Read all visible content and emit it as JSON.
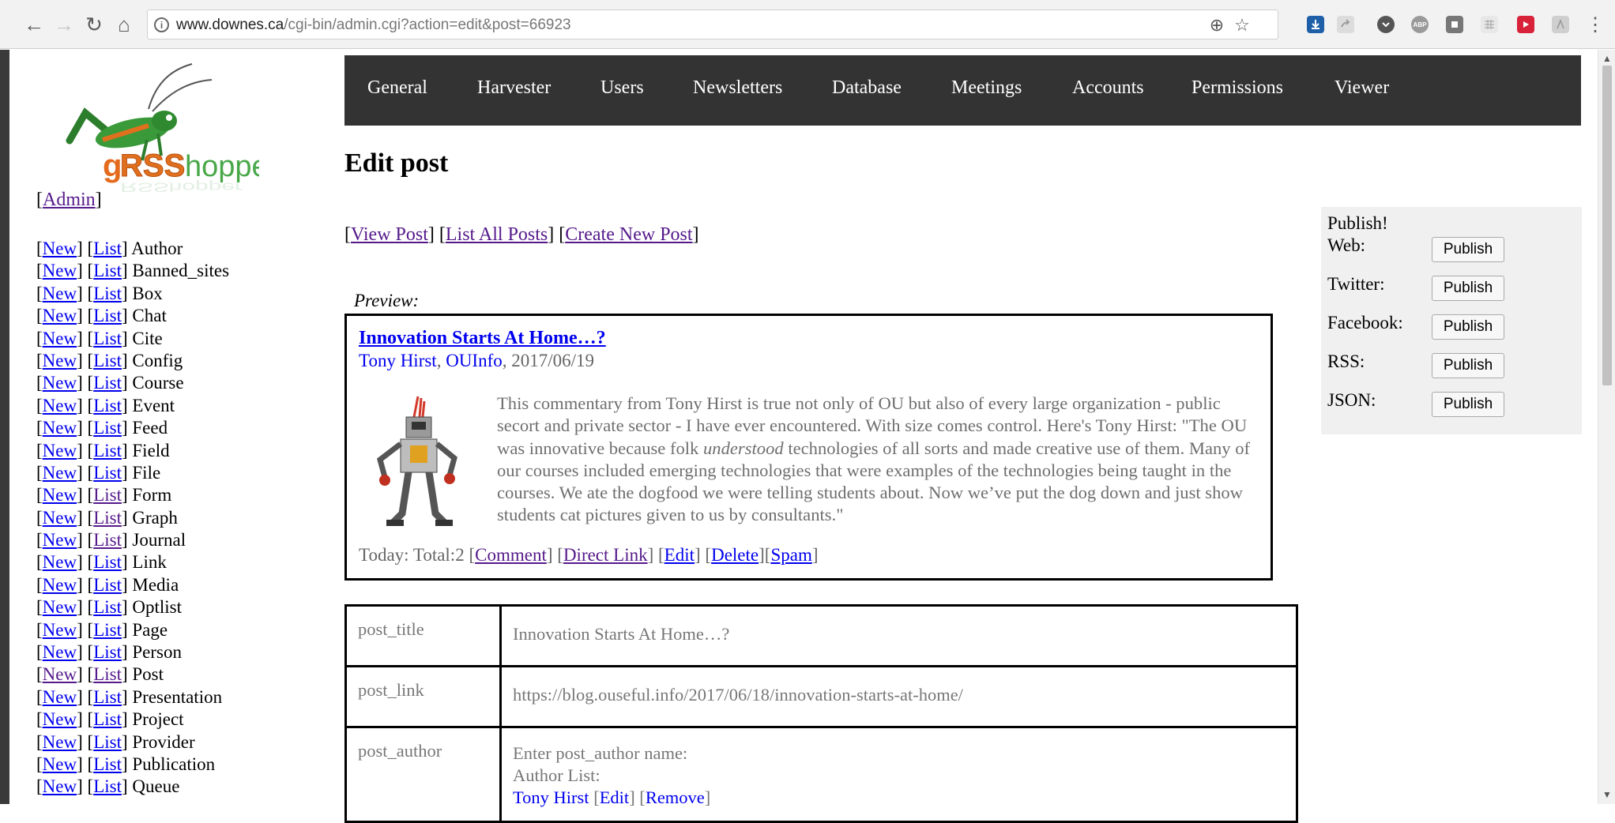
{
  "browser": {
    "url_domain": "www.downes.ca",
    "url_path": "/cgi-bin/admin.cgi?action=edit&post=66923",
    "back_icon": "←",
    "forward_icon": "→",
    "reload_icon": "↻",
    "home_icon": "⌂",
    "info_icon": "i",
    "zoom_icon": "⊕",
    "star_icon": "☆",
    "menu_icon": "⋮",
    "ext_abp": "ABP"
  },
  "sidebar": {
    "admin_link": "Admin",
    "new_label": "New",
    "list_label": "List",
    "tables": [
      "Author",
      "Banned_sites",
      "Box",
      "Chat",
      "Cite",
      "Config",
      "Course",
      "Event",
      "Feed",
      "Field",
      "File",
      "Form",
      "Graph",
      "Journal",
      "Link",
      "Media",
      "Optlist",
      "Page",
      "Person",
      "Post",
      "Presentation",
      "Project",
      "Provider",
      "Publication",
      "Queue"
    ]
  },
  "menu": {
    "items": [
      "General",
      "Harvester",
      "Users",
      "Newsletters",
      "Database",
      "Meetings",
      "Accounts",
      "Permissions",
      "Viewer"
    ]
  },
  "page": {
    "title": "Edit post",
    "view_post": "View Post",
    "list_all_posts": "List All Posts",
    "create_new_post": "Create New Post",
    "preview_label": "Preview:"
  },
  "preview": {
    "title": "Innovation Starts At Home…?",
    "author": "Tony Hirst",
    "source": "OUInfo",
    "date": ", 2017/06/19",
    "text_before": "This commentary from Tony Hirst is true not only of OU but also of every large organization - public secort and private sector - I have ever encountered. With size comes control. Here's Tony Hirst: \"The OU was innovative because folk ",
    "text_em": "understood",
    "text_after": " technologies of all sorts and made creative use of them. Many of our courses included emerging technologies that were examples of the technologies being taught in the courses. We ate the dogfood we were telling students about. Now we’ve put the dog down and just show students cat pictures given to us by consultants.\"",
    "footer_prefix": "Today: Total:2 ",
    "comment": "Comment",
    "direct_link": "Direct Link",
    "edit": "Edit",
    "delete": "Delete",
    "spam": "Spam"
  },
  "fields": {
    "post_title_key": "post_title",
    "post_title_val": "Innovation Starts At Home…?",
    "post_link_key": "post_link",
    "post_link_val": "https://blog.ouseful.info/2017/06/18/innovation-starts-at-home/",
    "post_author_key": "post_author",
    "post_author_prompt": "Enter post_author name:",
    "author_list_label": "Author List:",
    "author_name": "Tony Hirst",
    "edit_label": "Edit",
    "remove_label": "Remove"
  },
  "publish": {
    "heading": "Publish!",
    "button_label": "Publish",
    "targets": [
      "Web:",
      "Twitter:",
      "Facebook:",
      "RSS:",
      "JSON:"
    ]
  },
  "colors": {
    "menu_bg": "#333333",
    "link": "#0000ee",
    "visited": "#551a8b"
  }
}
